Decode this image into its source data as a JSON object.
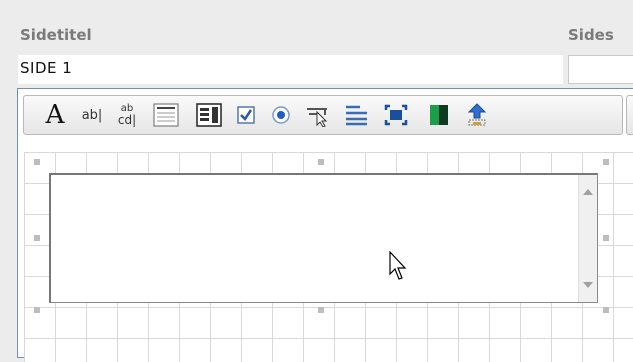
{
  "fields": {
    "title_label": "Sidetitel",
    "title_value": "SIDE 1",
    "second_label": "Sides"
  },
  "toolbar": {
    "tools": [
      {
        "icon": "text-label-icon",
        "text": "A"
      },
      {
        "icon": "text-field-icon",
        "text": "ab|"
      },
      {
        "icon": "text-area-icon",
        "text_top": "ab",
        "text_bottom": "cd|"
      },
      {
        "icon": "list-box-icon"
      },
      {
        "icon": "combo-box-icon"
      },
      {
        "icon": "checkbox-icon"
      },
      {
        "icon": "radio-button-icon"
      },
      {
        "icon": "button-icon"
      },
      {
        "icon": "align-left-icon"
      },
      {
        "icon": "frame-icon"
      },
      {
        "icon": "color-icon"
      },
      {
        "icon": "upload-icon"
      }
    ]
  },
  "colors": {
    "accent": "#6f8fb8",
    "label": "#7a7a7a"
  }
}
